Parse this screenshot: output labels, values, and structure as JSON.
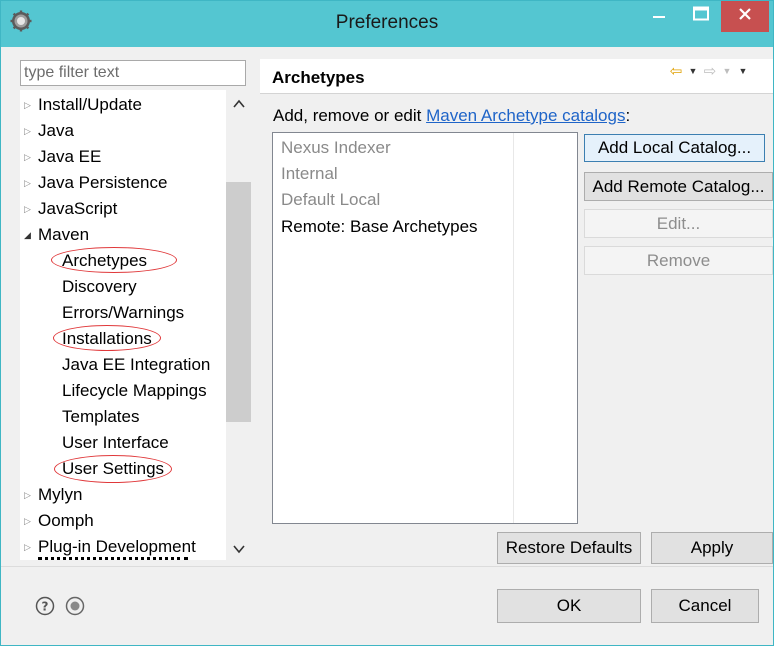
{
  "window": {
    "title": "Preferences",
    "icons": {
      "app": "eclipse-gear-icon",
      "minimize": "minimize-icon",
      "maximize": "maximize-icon",
      "close": "close-icon"
    },
    "colors": {
      "titlebar": "#54c6d1",
      "close": "#c75050",
      "highlight": "#e0383a",
      "link": "#1e64c8"
    }
  },
  "filter": {
    "placeholder": "type filter text",
    "value": ""
  },
  "tree": [
    {
      "label": "Install/Update",
      "level": 0,
      "state": "collapsed"
    },
    {
      "label": "Java",
      "level": 0,
      "state": "collapsed"
    },
    {
      "label": "Java EE",
      "level": 0,
      "state": "collapsed"
    },
    {
      "label": "Java Persistence",
      "level": 0,
      "state": "collapsed"
    },
    {
      "label": "JavaScript",
      "level": 0,
      "state": "collapsed"
    },
    {
      "label": "Maven",
      "level": 0,
      "state": "expanded"
    },
    {
      "label": "Archetypes",
      "level": 1,
      "highlighted": true
    },
    {
      "label": "Discovery",
      "level": 1
    },
    {
      "label": "Errors/Warnings",
      "level": 1
    },
    {
      "label": "Installations",
      "level": 1,
      "highlighted": true
    },
    {
      "label": "Java EE Integration",
      "level": 1
    },
    {
      "label": "Lifecycle Mappings",
      "level": 1
    },
    {
      "label": "Templates",
      "level": 1
    },
    {
      "label": "User Interface",
      "level": 1
    },
    {
      "label": "User Settings",
      "level": 1,
      "highlighted": true
    },
    {
      "label": "Mylyn",
      "level": 0,
      "state": "collapsed"
    },
    {
      "label": "Oomph",
      "level": 0,
      "state": "collapsed"
    },
    {
      "label": "Plug-in Development",
      "level": 0,
      "state": "collapsed"
    }
  ],
  "page": {
    "title": "Archetypes",
    "description_prefix": "Add, remove or edit ",
    "description_link": "Maven Archetype catalogs",
    "description_suffix": ":",
    "nav": {
      "back": "⇦",
      "forward": "⇨",
      "dropdown": "▼"
    }
  },
  "catalogs": [
    {
      "label": "Nexus Indexer",
      "enabled": false
    },
    {
      "label": "Internal",
      "enabled": false
    },
    {
      "label": "Default Local",
      "enabled": false
    },
    {
      "label": "Remote: Base Archetypes",
      "enabled": true
    }
  ],
  "buttons": {
    "add_local": "Add Local Catalog...",
    "add_remote": "Add Remote Catalog...",
    "edit": "Edit...",
    "remove": "Remove",
    "restore_defaults": "Restore Defaults",
    "apply": "Apply",
    "ok": "OK",
    "cancel": "Cancel"
  },
  "footer": {
    "help_icon": "help-icon",
    "record_icon": "record-icon"
  }
}
